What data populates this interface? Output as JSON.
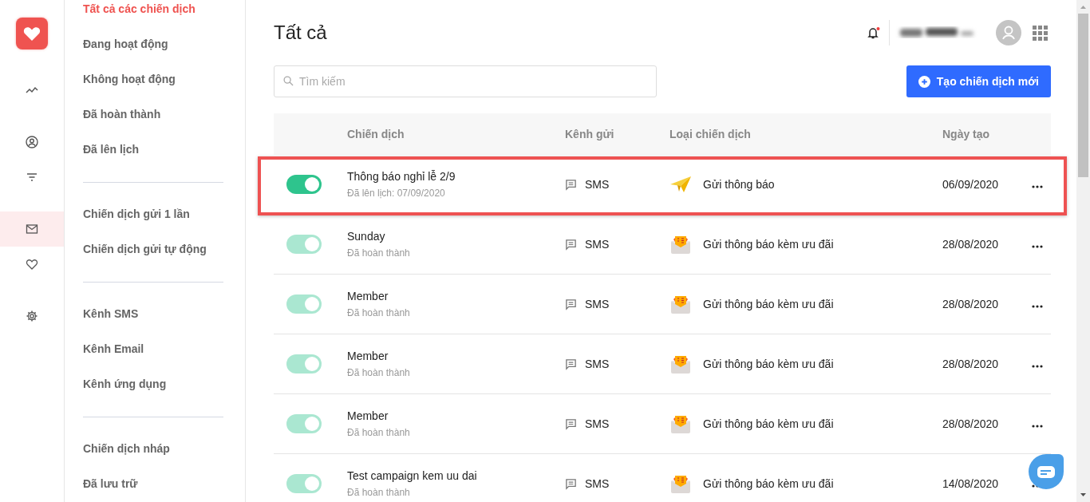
{
  "rail": {
    "groups": [
      {
        "items": [
          {
            "kind": "chart",
            "selected": false
          }
        ]
      },
      {
        "items": [
          {
            "kind": "user",
            "selected": false
          },
          {
            "kind": "filter",
            "selected": false
          }
        ]
      },
      {
        "items": [
          {
            "kind": "mail",
            "selected": true
          },
          {
            "kind": "heart",
            "selected": false
          }
        ]
      },
      {
        "items": [
          {
            "kind": "gear",
            "selected": false
          }
        ]
      }
    ]
  },
  "menu": {
    "groups": [
      {
        "items": [
          {
            "label": "Tất cả các chiến dịch",
            "selected": true
          },
          {
            "label": "Đang hoạt động",
            "selected": false
          },
          {
            "label": "Không hoạt động",
            "selected": false
          },
          {
            "label": "Đã hoàn thành",
            "selected": false
          },
          {
            "label": "Đã lên lịch",
            "selected": false
          }
        ]
      },
      {
        "items": [
          {
            "label": "Chiến dịch gửi 1 lần",
            "selected": false
          },
          {
            "label": "Chiến dịch gửi tự động",
            "selected": false
          }
        ]
      },
      {
        "items": [
          {
            "label": "Kênh SMS",
            "selected": false
          },
          {
            "label": "Kênh Email",
            "selected": false
          },
          {
            "label": "Kênh ứng dụng",
            "selected": false
          }
        ]
      },
      {
        "items": [
          {
            "label": "Chiến dịch nháp",
            "selected": false
          },
          {
            "label": "Đã lưu trữ",
            "selected": false
          }
        ]
      }
    ]
  },
  "header": {
    "title": "Tất cả",
    "notifications": {
      "unread": true
    }
  },
  "search": {
    "placeholder": "Tìm kiếm"
  },
  "create_button": "Tạo chiến dịch mới",
  "table": {
    "columns": [
      "Chiến dịch",
      "Kênh gửi",
      "Loại chiến dịch",
      "Ngày tạo"
    ],
    "rows": [
      {
        "on": true,
        "disabled": false,
        "highlighted": true,
        "name": "Thông báo nghỉ lễ 2/9",
        "status": "Đã lên lịch: 07/09/2020",
        "channel": "SMS",
        "type": {
          "kind": "notice",
          "label": "Gửi thông báo"
        },
        "date": "06/09/2020"
      },
      {
        "on": true,
        "disabled": true,
        "highlighted": false,
        "name": "Sunday",
        "status": "Đã hoàn thành",
        "channel": "SMS",
        "type": {
          "kind": "promo",
          "label": "Gửi thông báo kèm ưu đãi"
        },
        "date": "28/08/2020"
      },
      {
        "on": true,
        "disabled": true,
        "highlighted": false,
        "name": "Member",
        "status": "Đã hoàn thành",
        "channel": "SMS",
        "type": {
          "kind": "promo",
          "label": "Gửi thông báo kèm ưu đãi"
        },
        "date": "28/08/2020"
      },
      {
        "on": true,
        "disabled": true,
        "highlighted": false,
        "name": "Member",
        "status": "Đã hoàn thành",
        "channel": "SMS",
        "type": {
          "kind": "promo",
          "label": "Gửi thông báo kèm ưu đãi"
        },
        "date": "28/08/2020"
      },
      {
        "on": true,
        "disabled": true,
        "highlighted": false,
        "name": "Member",
        "status": "Đã hoàn thành",
        "channel": "SMS",
        "type": {
          "kind": "promo",
          "label": "Gửi thông báo kèm ưu đãi"
        },
        "date": "28/08/2020"
      },
      {
        "on": true,
        "disabled": true,
        "highlighted": false,
        "name": "Test campaign kem uu dai",
        "status": "Đã hoàn thành",
        "channel": "SMS",
        "type": {
          "kind": "promo",
          "label": "Gửi thông báo kèm ưu đãi"
        },
        "date": "14/08/2020"
      }
    ]
  }
}
